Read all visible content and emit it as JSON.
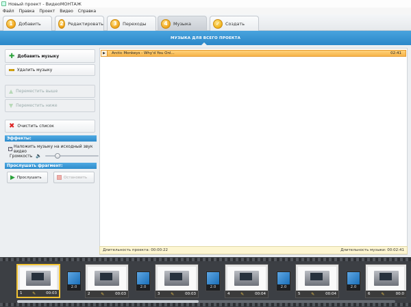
{
  "window": {
    "title": "Новый проект - ВидеоМОНТАЖ"
  },
  "menu": [
    "Файл",
    "Правка",
    "Проект",
    "Видео",
    "Справка"
  ],
  "tabs": [
    {
      "num": "1",
      "label": "Добавить"
    },
    {
      "num": "2",
      "label": "Редактировать"
    },
    {
      "num": "3",
      "label": "Переходы"
    },
    {
      "num": "4",
      "label": "Музыка"
    },
    {
      "num": "✓",
      "label": "Создать"
    }
  ],
  "active_tab": "Музыка",
  "banner": "МУЗЫКА ДЛЯ ВСЕГО ПРОЕКТА",
  "left": {
    "add_music": "Добавить музыку",
    "remove_music": "Удалить музыку",
    "move_up": "Переместить выше",
    "move_down": "Переместить ниже",
    "clear_list": "Очистить список",
    "effects_header": "Эффекты:",
    "overlay_checkbox": "Наложить музыку на исходный звук видео",
    "overlay_checked": true,
    "volume_label": "Громкость",
    "volume_level": 0.2,
    "preview_header": "Прослушать фрагмент:",
    "listen": "Прослушать",
    "stop": "Остановить"
  },
  "playlist": [
    {
      "title": "Arctic Monkeys - Why'd You Onl...",
      "duration": "02:41"
    }
  ],
  "footer": {
    "project_duration": "Длительность проекта: 00:00:22",
    "music_duration": "Длительность музыки: 00:02:41"
  },
  "timeline": {
    "clips": [
      {
        "index": "1",
        "duration": "00:03"
      },
      {
        "index": "2",
        "duration": "00:03"
      },
      {
        "index": "3",
        "duration": "00:03"
      },
      {
        "index": "4",
        "duration": "00:04"
      },
      {
        "index": "5",
        "duration": "00:04"
      },
      {
        "index": "6",
        "duration": "00:0"
      }
    ],
    "transitions": [
      "2.0",
      "2.0",
      "2.0",
      "2.0",
      "2.0",
      "2.0"
    ]
  },
  "colors": {
    "accent": "#2f8ccc",
    "track": "#f7b44a",
    "selected_clip": "#f1c232"
  }
}
